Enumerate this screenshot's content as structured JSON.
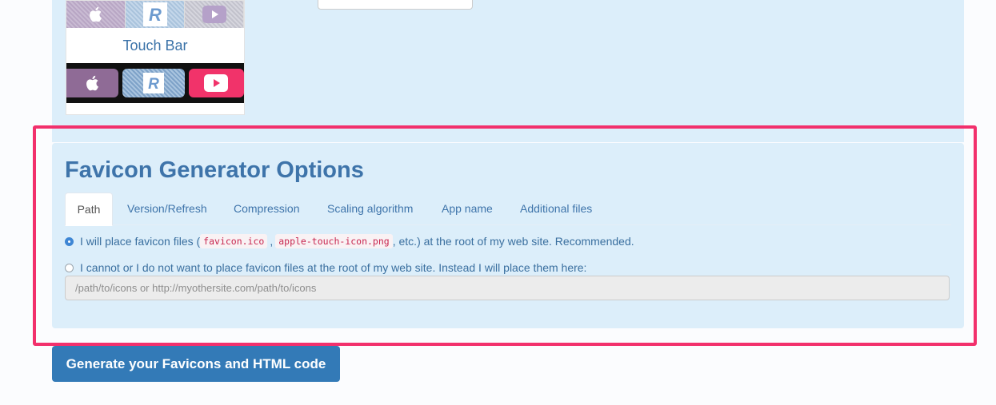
{
  "preview": {
    "touch_bar_label": "Touch Bar",
    "tile_icons": [
      "apple-icon",
      "r-letter-icon",
      "youtube-icon"
    ],
    "r_letter": "R"
  },
  "options": {
    "title": "Favicon Generator Options",
    "tabs": [
      {
        "label": "Path",
        "active": true
      },
      {
        "label": "Version/Refresh",
        "active": false
      },
      {
        "label": "Compression",
        "active": false
      },
      {
        "label": "Scaling algorithm",
        "active": false
      },
      {
        "label": "App name",
        "active": false
      },
      {
        "label": "Additional files",
        "active": false
      }
    ],
    "root_option": {
      "checked": true,
      "text_before": "I will place favicon files (",
      "code_1": "favicon.ico",
      "separator": ",",
      "code_2": "apple-touch-icon.png",
      "text_after": ", etc.) at the root of my web site. Recommended."
    },
    "custom_option": {
      "checked": false,
      "text": "I cannot or I do not want to place favicon files at the root of my web site. Instead I will place them here:"
    },
    "path_input": {
      "value": "",
      "placeholder": "/path/to/icons or http://myothersite.com/path/to/icons"
    }
  },
  "generate_button": "Generate your Favicons and HTML code",
  "colors": {
    "highlight": "#f2306c",
    "panel": "#dceefa",
    "title": "#3e74aa",
    "button": "#337ab7"
  }
}
